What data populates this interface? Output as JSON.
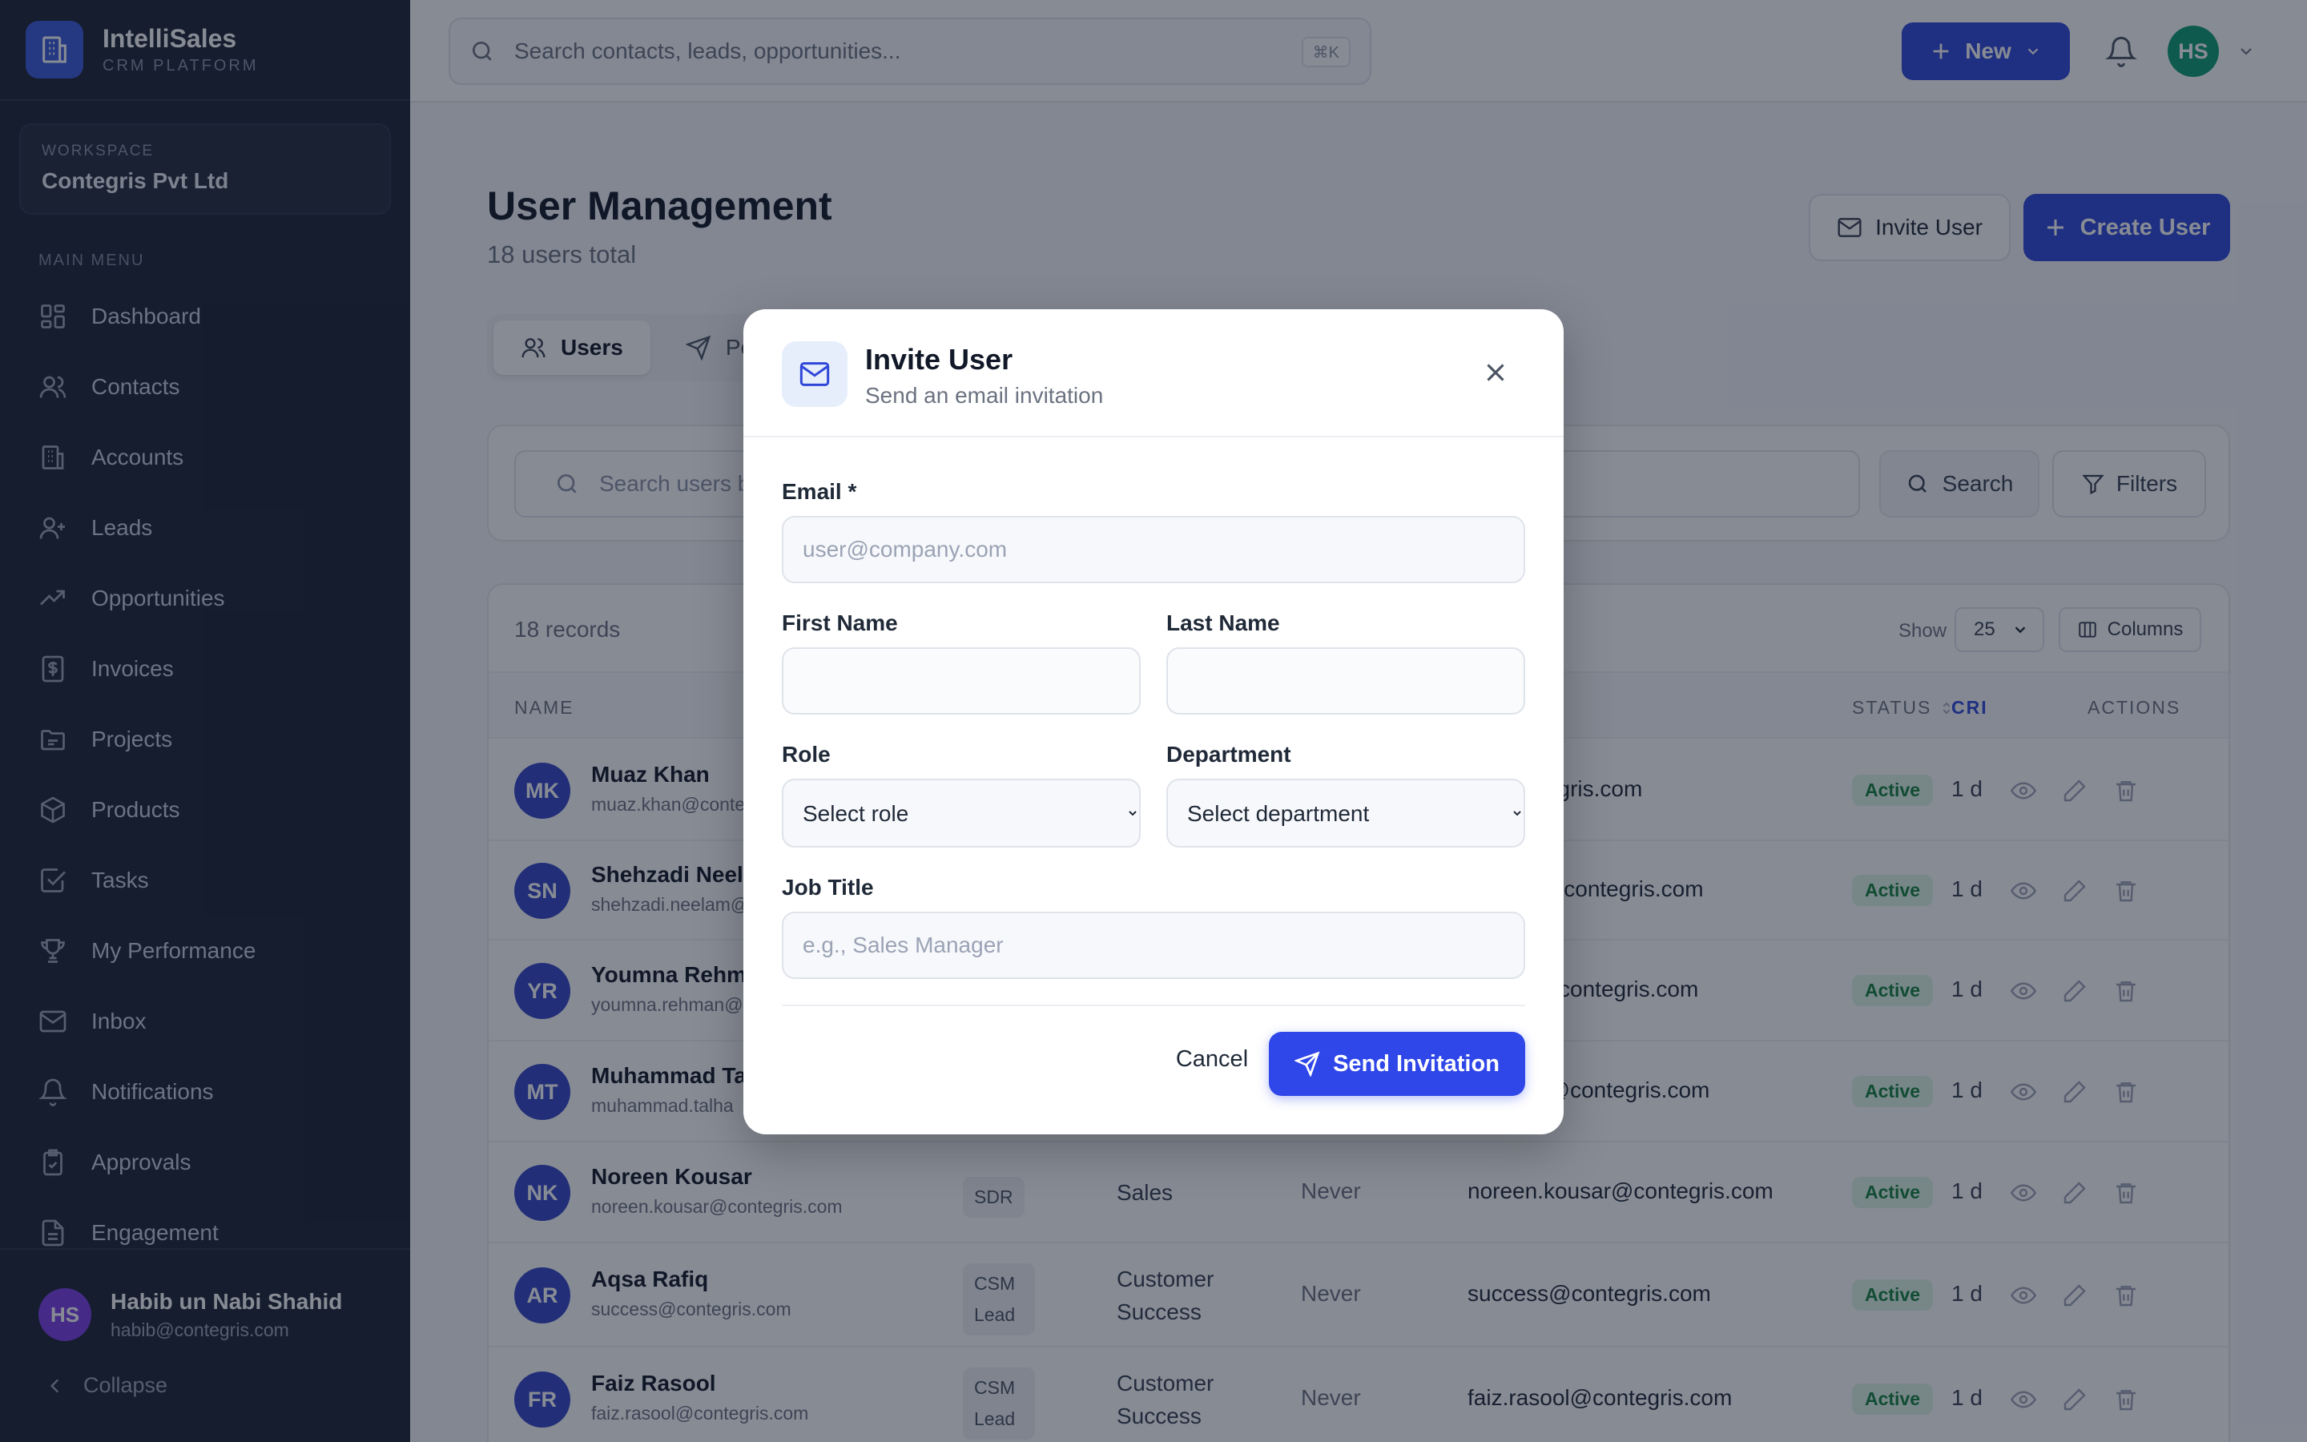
{
  "brand": {
    "name": "IntelliSales",
    "subtitle": "CRM PLATFORM"
  },
  "workspace": {
    "label": "WORKSPACE",
    "name": "Contegris Pvt Ltd"
  },
  "sidebar": {
    "menu_label": "MAIN MENU",
    "items": [
      {
        "label": "Dashboard",
        "icon": "dashboard-icon"
      },
      {
        "label": "Contacts",
        "icon": "users-icon"
      },
      {
        "label": "Accounts",
        "icon": "building-icon"
      },
      {
        "label": "Leads",
        "icon": "user-plus-icon"
      },
      {
        "label": "Opportunities",
        "icon": "trending-up-icon"
      },
      {
        "label": "Invoices",
        "icon": "invoice-icon"
      },
      {
        "label": "Projects",
        "icon": "folder-icon"
      },
      {
        "label": "Products",
        "icon": "box-icon"
      },
      {
        "label": "Tasks",
        "icon": "check-square-icon"
      },
      {
        "label": "My Performance",
        "icon": "trophy-icon"
      },
      {
        "label": "Inbox",
        "icon": "mail-icon"
      },
      {
        "label": "Notifications",
        "icon": "bell-icon"
      },
      {
        "label": "Approvals",
        "icon": "clipboard-check-icon"
      },
      {
        "label": "Engagement",
        "icon": "document-icon"
      }
    ],
    "user": {
      "initials": "HS",
      "name": "Habib un Nabi Shahid",
      "email": "habib@contegris.com"
    },
    "collapse_label": "Collapse"
  },
  "topbar": {
    "search_placeholder": "Search contacts, leads, opportunities...",
    "shortcut": "⌘K",
    "new_label": "New",
    "avatar_initials": "HS"
  },
  "page": {
    "title": "User Management",
    "subtitle": "18 users total",
    "invite_label": "Invite User",
    "create_label": "Create User",
    "tabs": [
      {
        "label": "Users"
      },
      {
        "label": "Pen"
      }
    ],
    "search_placeholder": "Search users by n",
    "search_button": "Search",
    "filters_button": "Filters"
  },
  "table": {
    "records": "18 records",
    "show_label": "Show",
    "page_size": "25",
    "columns_button": "Columns",
    "headers": {
      "name": "NAME",
      "status": "STATUS",
      "cri": "CRI",
      "actions": "ACTIONS"
    },
    "rows": [
      {
        "initials": "MK",
        "name": "Muaz Khan",
        "email": "muaz.khan@conte",
        "role": "",
        "dept": "",
        "last": "",
        "email_col": "n@contegris.com",
        "status": "Active",
        "cri": "1 d"
      },
      {
        "initials": "SN",
        "name": "Shehzadi Neelu",
        "email": "shehzadi.neelam@",
        "role": "",
        "dept": "",
        "last": "",
        "email_col": "neelam@contegris.com",
        "status": "Active",
        "cri": "1 d"
      },
      {
        "initials": "YR",
        "name": "Youmna Rehma",
        "email": "youmna.rehman@",
        "role": "",
        "dept": "",
        "last": "",
        "email_col": "ehman@contegris.com",
        "status": "Active",
        "cri": "1 d"
      },
      {
        "initials": "MT",
        "name": "Muhammad Ta",
        "email": "muhammad.talha",
        "role": "",
        "dept": "",
        "last": "",
        "email_col": "ad.talha@contegris.com",
        "status": "Active",
        "cri": "1 d"
      },
      {
        "initials": "NK",
        "name": "Noreen Kousar",
        "email": "noreen.kousar@contegris.com",
        "role": "SDR",
        "dept": "Sales",
        "last": "Never",
        "email_col": "noreen.kousar@contegris.com",
        "status": "Active",
        "cri": "1 d"
      },
      {
        "initials": "AR",
        "name": "Aqsa Rafiq",
        "email": "success@contegris.com",
        "role": "CSM Lead",
        "dept": "Customer Success",
        "last": "Never",
        "email_col": "success@contegris.com",
        "status": "Active",
        "cri": "1 d"
      },
      {
        "initials": "FR",
        "name": "Faiz Rasool",
        "email": "faiz.rasool@contegris.com",
        "role": "CSM Lead",
        "dept": "Customer Success",
        "last": "Never",
        "email_col": "faiz.rasool@contegris.com",
        "status": "Active",
        "cri": "1 d"
      }
    ]
  },
  "modal": {
    "title": "Invite User",
    "subtitle": "Send an email invitation",
    "email_label": "Email *",
    "email_placeholder": "user@company.com",
    "first_name_label": "First Name",
    "last_name_label": "Last Name",
    "role_label": "Role",
    "role_value": "Select role",
    "department_label": "Department",
    "department_value": "Select department",
    "job_title_label": "Job Title",
    "job_title_placeholder": "e.g., Sales Manager",
    "cancel_label": "Cancel",
    "send_label": "Send Invitation"
  },
  "colors": {
    "accent": "#2f47d8",
    "sidebar": "#1b2233",
    "active_badge": "#def7e7"
  }
}
